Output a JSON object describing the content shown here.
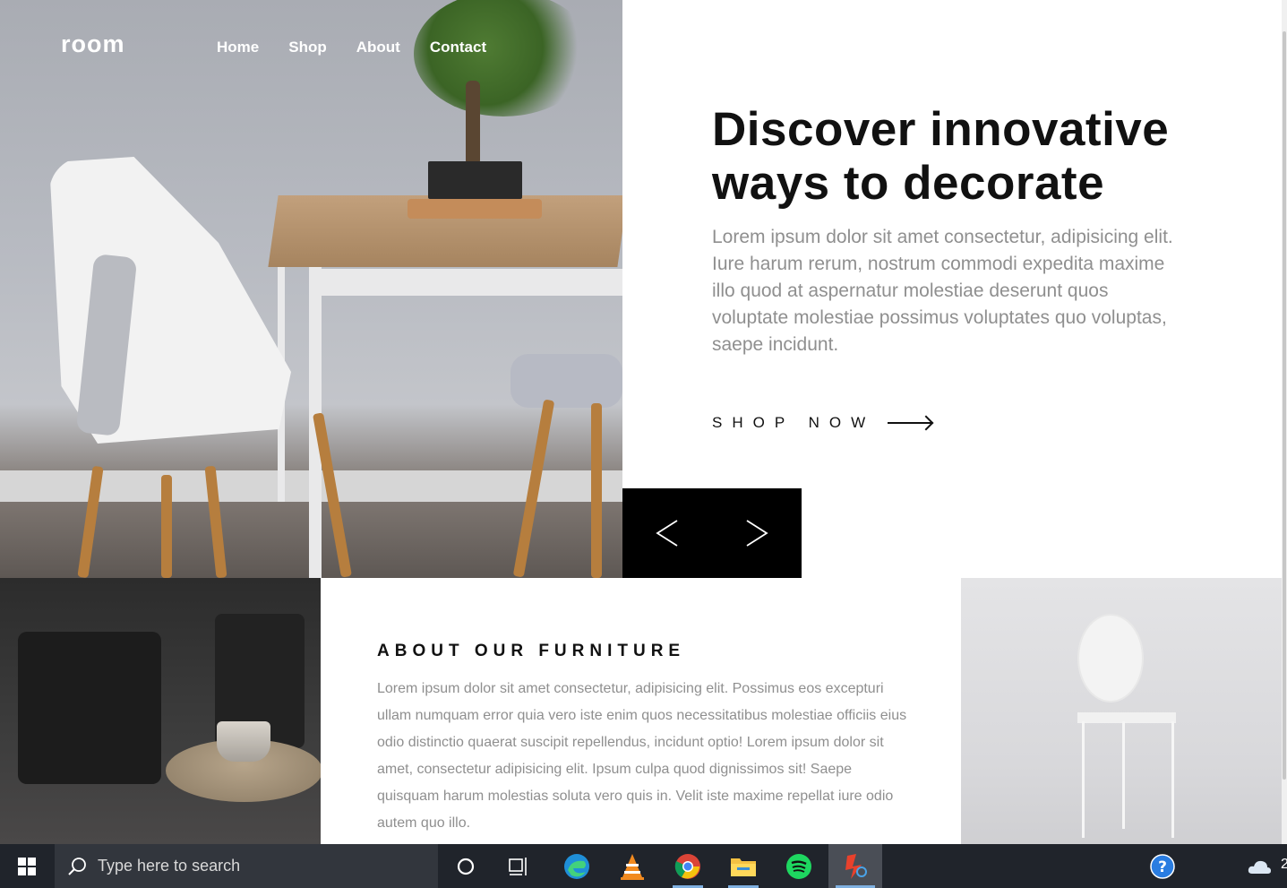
{
  "site": {
    "logo": "room",
    "nav": [
      "Home",
      "Shop",
      "About",
      "Contact"
    ]
  },
  "hero": {
    "title": "Discover innovative ways to decorate",
    "description": "Lorem ipsum dolor sit amet consectetur, adipisicing elit. Iure harum rerum, nostrum commodi expedita maxime illo quod at aspernatur molestiae deserunt quos voluptate molestiae possimus voluptates quo voluptas, saepe incidunt.",
    "cta_label": "SHOP NOW",
    "slider": {
      "prev_icon": "angle-left-icon",
      "next_icon": "angle-right-icon"
    }
  },
  "about": {
    "title": "ABOUT OUR FURNITURE",
    "description": "Lorem ipsum dolor sit amet consectetur, adipisicing elit. Possimus eos excepturi ullam numquam error quia vero iste enim quos necessitatibus molestiae officiis eius odio distinctio quaerat suscipit repellendus, incidunt optio! Lorem ipsum dolor sit amet, consectetur adipisicing elit. Ipsum culpa quod dignissimos sit! Saepe quisquam harum molestias soluta vero quis in. Velit iste maxime repellat iure odio autem quo illo."
  },
  "taskbar": {
    "search_placeholder": "Type here to search",
    "apps": [
      "cortana-icon",
      "task-view-icon",
      "edge-icon",
      "vlc-icon",
      "chrome-icon",
      "file-explorer-icon",
      "spotify-icon",
      "pinned-app-icon"
    ],
    "tray_partial_text": "2",
    "colors": {
      "background": "#20242b",
      "search_box": "#32363d"
    }
  },
  "colors": {
    "accent_dark": "#000000",
    "heading": "#111111",
    "body_text": "#8f8f8f"
  }
}
